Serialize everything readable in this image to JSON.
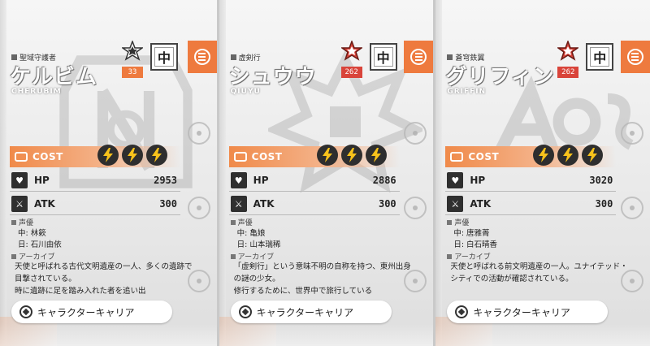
{
  "cards": [
    {
      "organization": "聖域守護者",
      "name": "ケルビム",
      "romaji": "CHERUBIM",
      "rank_level": "33",
      "rank_color": "#ee7a3e",
      "size_label": "中",
      "cost_label": "COST",
      "cost_value": 3,
      "hp_label": "HP",
      "hp_value": "2953",
      "atk_label": "ATK",
      "atk_value": "300",
      "voice_label": "声優",
      "voice_cn": "中:  林簌",
      "voice_jp": "日:  石川由依",
      "archive_label": "アーカイブ",
      "description": "天使と呼ばれる古代文明遺産の一人、多くの遺跡で目撃されている。\n時に遺跡に足を踏み入れた者を追い出",
      "career_button": "キャラクターキャリア"
    },
    {
      "organization": "虚剣行",
      "name": "シュウウ",
      "romaji": "QIUYU",
      "rank_level": "262",
      "rank_color": "#d9443a",
      "size_label": "中",
      "cost_label": "COST",
      "cost_value": 3,
      "hp_label": "HP",
      "hp_value": "2886",
      "atk_label": "ATK",
      "atk_value": "300",
      "voice_label": "声優",
      "voice_cn": "中:  亀娘",
      "voice_jp": "日:  山本瑞稀",
      "archive_label": "アーカイブ",
      "description": "「虚剣行」という意味不明の自称を持つ、東州出身の謎の少女。\n修行するために、世界中で旅行している",
      "career_button": "キャラクターキャリア"
    },
    {
      "organization": "蒼穹鉄翼",
      "name": "グリフィン",
      "romaji": "GRIFFIN",
      "rank_level": "262",
      "rank_color": "#d9443a",
      "size_label": "中",
      "cost_label": "COST",
      "cost_value": 3,
      "hp_label": "HP",
      "hp_value": "3020",
      "atk_label": "ATK",
      "atk_value": "300",
      "voice_label": "声優",
      "voice_cn": "中:  唐雅菁",
      "voice_jp": "日:  白石晴香",
      "archive_label": "アーカイブ",
      "description": "天使と呼ばれる前文明遺産の一人。ユナイテッド・シティでの活動が確認されている。",
      "career_button": "キャラクターキャリア"
    }
  ],
  "colors": {
    "accent": "#ee7a3e",
    "dark": "#2e2e2e",
    "bolt": "#f7c21b"
  },
  "icons": {
    "menu": "list-icon",
    "bolt": "lightning-icon",
    "hp": "heart-icon",
    "atk": "sword-icon",
    "career": "career-icon"
  }
}
